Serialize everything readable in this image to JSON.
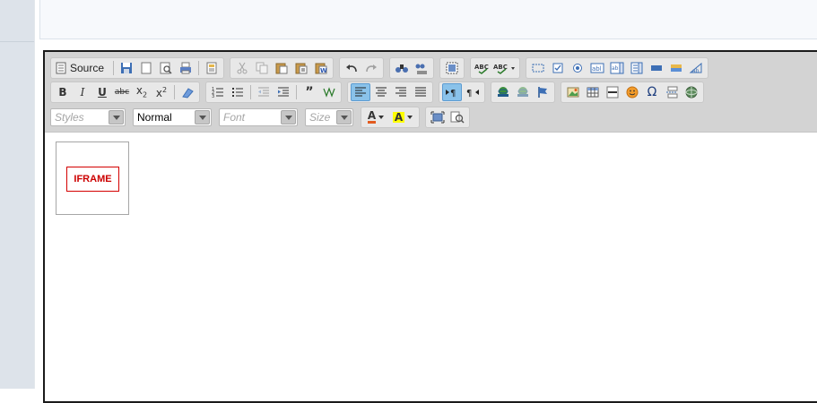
{
  "editor": {
    "iframe_placeholder_label": "IFRAME"
  },
  "toolbar": {
    "source_label": "Source",
    "row1": {
      "groups": [
        [
          "source-button",
          "save-icon",
          "new-page-icon",
          "preview-icon",
          "print-icon",
          "templates-icon"
        ],
        [
          "cut-icon",
          "copy-icon",
          "paste-icon",
          "paste-text-icon",
          "paste-word-icon"
        ],
        [
          "undo-icon",
          "redo-icon"
        ],
        [
          "find-icon",
          "replace-icon"
        ],
        [
          "select-all-icon"
        ],
        [
          "spellcheck-icon",
          "spellcheck-as-you-type-icon"
        ],
        [
          "form-icon",
          "checkbox-icon",
          "radio-icon",
          "textfield-icon",
          "textarea-icon",
          "select-icon",
          "button-icon",
          "image-button-icon",
          "hidden-field-icon"
        ]
      ]
    },
    "row2": {
      "groups": [
        [
          "bold-icon",
          "italic-icon",
          "underline-icon",
          "strikethrough-icon",
          "subscript-icon",
          "superscript-icon",
          "remove-format-icon"
        ],
        [
          "numbered-list-icon",
          "bulleted-list-icon",
          "decrease-indent-icon",
          "increase-indent-icon",
          "blockquote-icon",
          "create-div-icon"
        ],
        [
          "align-left-icon",
          "align-center-icon",
          "align-right-icon",
          "justify-icon"
        ],
        [
          "ltr-icon",
          "rtl-icon"
        ],
        [
          "link-icon",
          "unlink-icon",
          "anchor-icon"
        ],
        [
          "image-icon",
          "table-icon",
          "horizontal-rule-icon",
          "smiley-icon",
          "special-char-icon",
          "page-break-icon",
          "iframe-icon"
        ]
      ],
      "active": [
        "align-left-icon",
        "ltr-icon"
      ]
    },
    "row3": {
      "styles_placeholder": "Styles",
      "format_value": "Normal",
      "font_placeholder": "Font",
      "size_placeholder": "Size",
      "text_color_glyph": "A",
      "bg_color_glyph": "A",
      "colors": {
        "text_color_bar": "#e25b1f",
        "bg_color_highlight": "#ffff00"
      },
      "tools": [
        "maximize-icon",
        "show-blocks-icon"
      ]
    }
  }
}
